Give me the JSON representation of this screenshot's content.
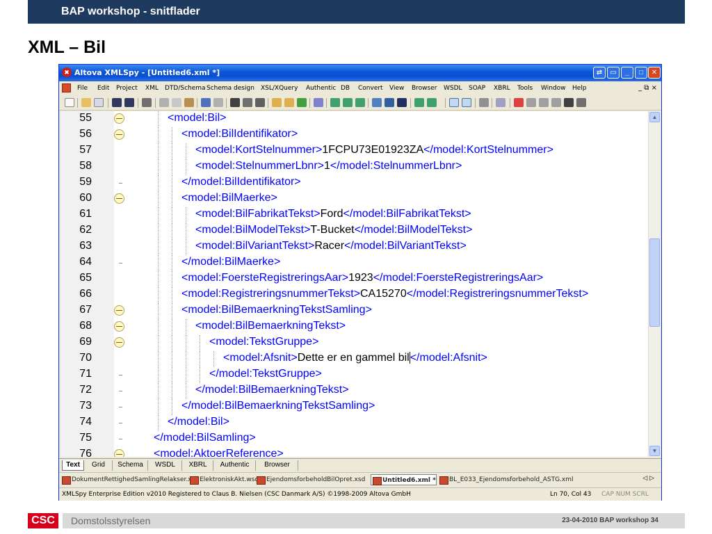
{
  "slide": {
    "header": "BAP workshop - snitflader",
    "title": "XML – Bil",
    "footer_logo": "CSC",
    "footer_left": "Domstolsstyrelsen",
    "footer_right": "23-04-2010 BAP workshop  34"
  },
  "app": {
    "logo": "✖",
    "title": "Altova XMLSpy - [Untitled6.xml *]",
    "window_controls": [
      "⇄",
      "▭",
      "_",
      "□",
      "✕"
    ],
    "menu": [
      "File",
      "Edit",
      "Project",
      "XML",
      "DTD/Schema",
      "Schema design",
      "XSL/XQuery",
      "Authentic",
      "DB",
      "Convert",
      "View",
      "Browser",
      "WSDL",
      "SOAP",
      "XBRL",
      "Tools",
      "Window",
      "Help"
    ],
    "mdi_controls": "_ ⧉ ×"
  },
  "editor": {
    "lines": [
      {
        "num": "55",
        "open": "<model:Bil>",
        "text": "",
        "close": ""
      },
      {
        "num": "56",
        "open": "<model:BilIdentifikator>",
        "text": "",
        "close": ""
      },
      {
        "num": "57",
        "open": "<model:KortStelnummer>",
        "text": "1FCPU73E01923ZA",
        "close": "</model:KortStelnummer>"
      },
      {
        "num": "58",
        "open": "<model:StelnummerLbnr>",
        "text": "1",
        "close": "</model:StelnummerLbnr>"
      },
      {
        "num": "59",
        "open": "</model:BilIdentifikator>",
        "text": "",
        "close": ""
      },
      {
        "num": "60",
        "open": "<model:BilMaerke>",
        "text": "",
        "close": ""
      },
      {
        "num": "61",
        "open": "<model:BilFabrikatTekst>",
        "text": "Ford",
        "close": "</model:BilFabrikatTekst>"
      },
      {
        "num": "62",
        "open": "<model:BilModelTekst>",
        "text": "T-Bucket",
        "close": "</model:BilModelTekst>"
      },
      {
        "num": "63",
        "open": "<model:BilVariantTekst>",
        "text": "Racer",
        "close": "</model:BilVariantTekst>"
      },
      {
        "num": "64",
        "open": "</model:BilMaerke>",
        "text": "",
        "close": ""
      },
      {
        "num": "65",
        "open": "<model:FoersteRegistreringsAar>",
        "text": "1923",
        "close": "</model:FoersteRegistreringsAar>"
      },
      {
        "num": "66",
        "open": "<model:RegistreringsnummerTekst>",
        "text": "CA15270",
        "close": "</model:RegistreringsnummerTekst>"
      },
      {
        "num": "67",
        "open": "<model:BilBemaerkningTekstSamling>",
        "text": "",
        "close": ""
      },
      {
        "num": "68",
        "open": "<model:BilBemaerkningTekst>",
        "text": "",
        "close": ""
      },
      {
        "num": "69",
        "open": "<model:TekstGruppe>",
        "text": "",
        "close": ""
      },
      {
        "num": "70",
        "open": "<model:Afsnit>",
        "text": "Dette er en gammel bil",
        "close": "</model:Afsnit>"
      },
      {
        "num": "71",
        "open": "</model:TekstGruppe>",
        "text": "",
        "close": ""
      },
      {
        "num": "72",
        "open": "</model:BilBemaerkningTekst>",
        "text": "",
        "close": ""
      },
      {
        "num": "73",
        "open": "</model:BilBemaerkningTekstSamling>",
        "text": "",
        "close": ""
      },
      {
        "num": "74",
        "open": "</model:Bil>",
        "text": "",
        "close": ""
      },
      {
        "num": "75",
        "open": "</model:BilSamling>",
        "text": "",
        "close": ""
      },
      {
        "num": "76",
        "open": "<model:AktoerReference>",
        "text": "",
        "close": ""
      }
    ]
  },
  "view_tabs": [
    "Text",
    "Grid",
    "Schema",
    "WSDL",
    "XBRL",
    "Authentic",
    "Browser"
  ],
  "doc_tabs": [
    "DokumentRettighedSamlingRelakser.xsd",
    "ElektroniskAkt.wsdl",
    "EjendomsforbeholdBilOpret.xsd",
    "Untitled6.xml *",
    "BL_E033_Ejendomsforbehold_ASTG.xml"
  ],
  "doc_tab_nav": "◁  ▷",
  "status": {
    "edition": "XMLSpy Enterprise Edition v2010   Registered to Claus B. Nielsen (CSC Danmark A/S)   ©1998-2009 Altova GmbH",
    "position": "Ln 70, Col 43",
    "indicators": "CAP  NUM  SCRL"
  }
}
